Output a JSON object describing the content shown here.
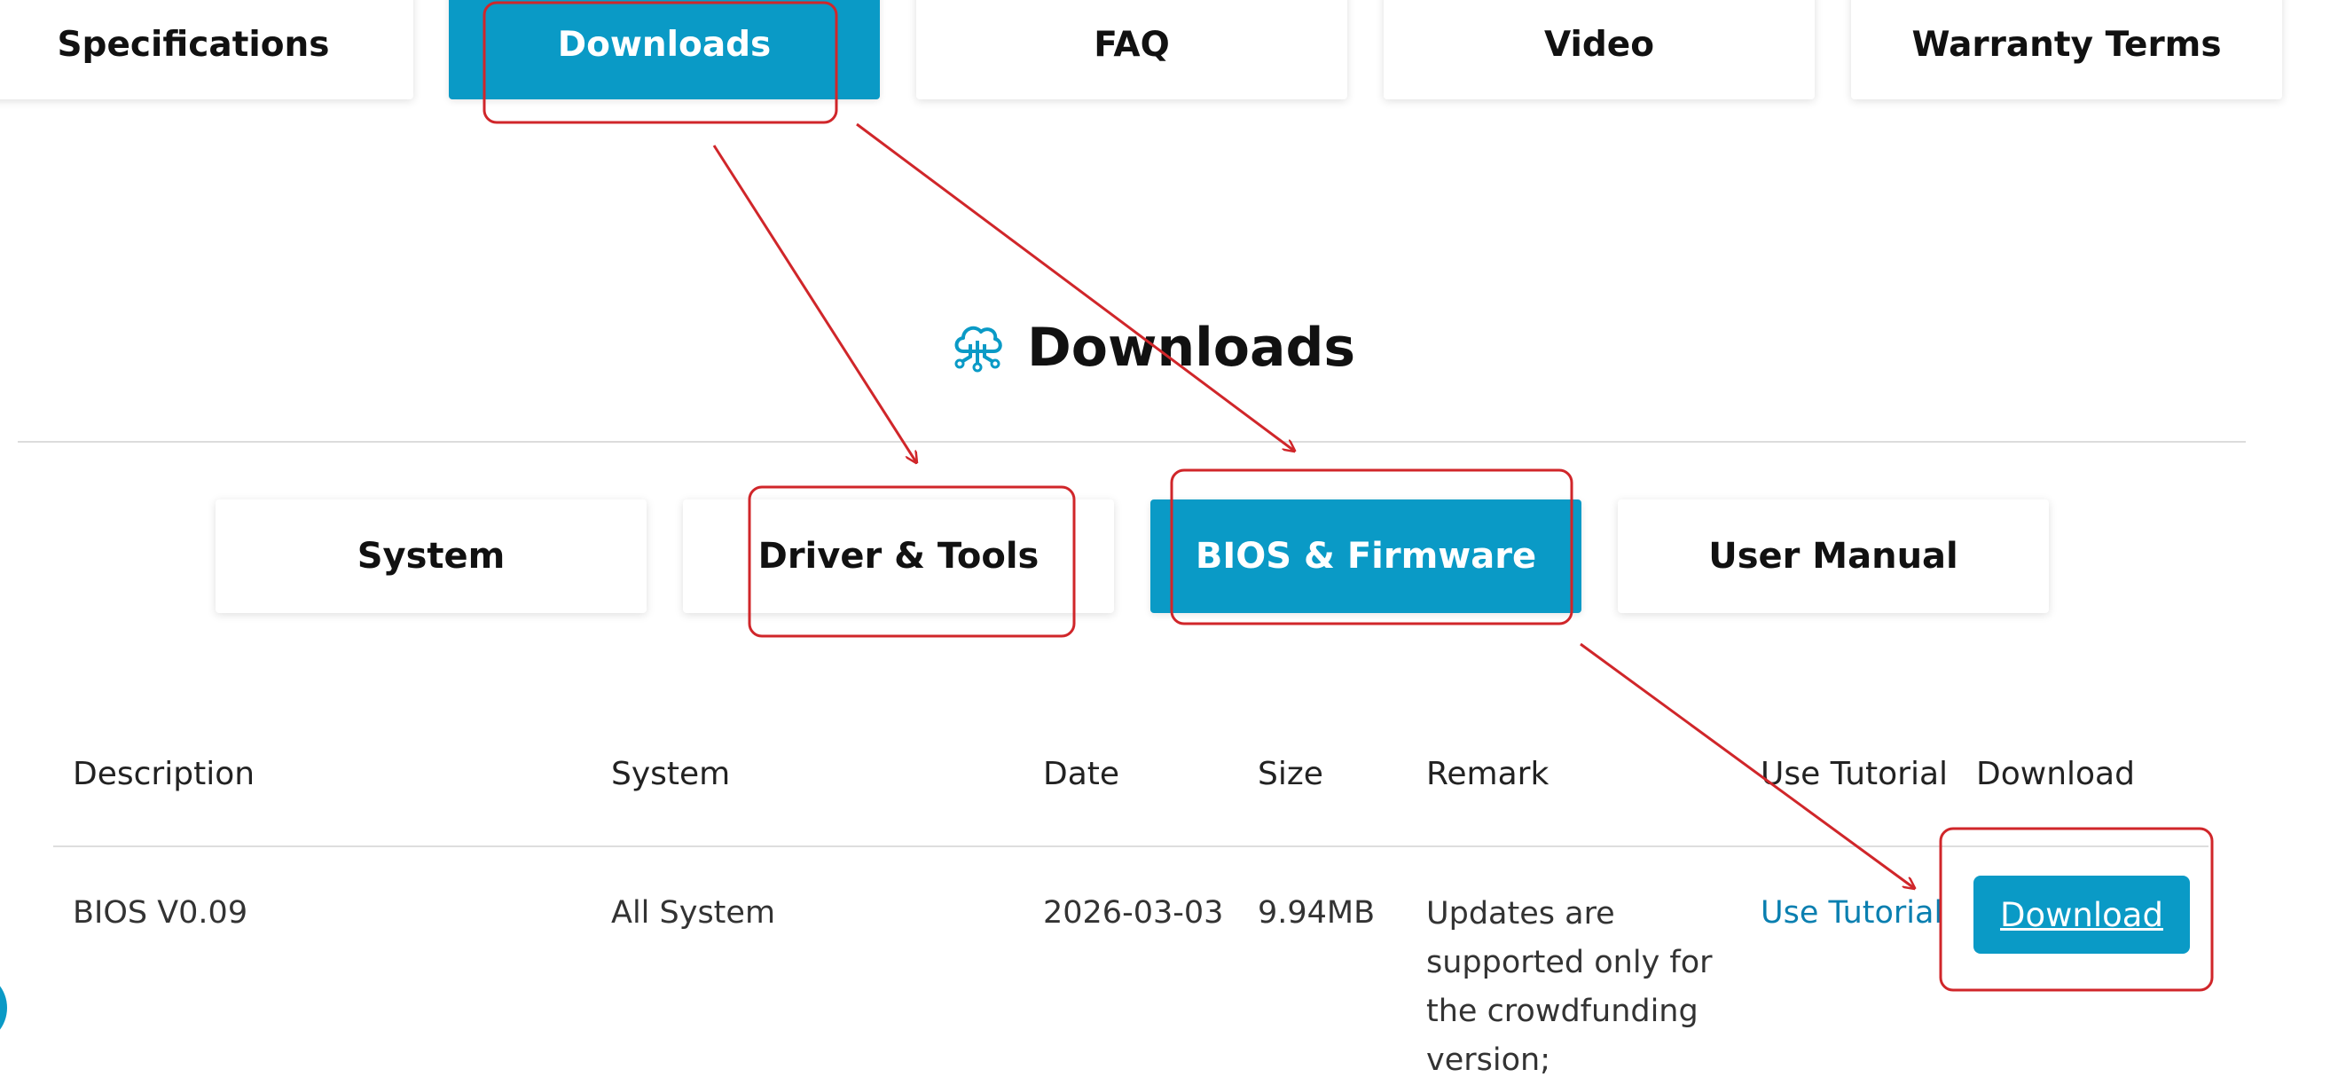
{
  "top_tabs": [
    {
      "label": "Specifications",
      "active": false
    },
    {
      "label": "Downloads",
      "active": true
    },
    {
      "label": "FAQ",
      "active": false
    },
    {
      "label": "Video",
      "active": false
    },
    {
      "label": "Warranty Terms",
      "active": false
    }
  ],
  "section": {
    "title": "Downloads",
    "icon": "cloud-network-icon"
  },
  "sub_tabs": [
    {
      "label": "System",
      "active": false
    },
    {
      "label": "Driver & Tools",
      "active": false
    },
    {
      "label": "BIOS & Firmware",
      "active": true
    },
    {
      "label": "User Manual",
      "active": false
    }
  ],
  "table": {
    "headers": [
      "Description",
      "System",
      "Date",
      "Size",
      "Remark",
      "Use Tutorial",
      "Download"
    ],
    "rows": [
      {
        "description": "BIOS V0.09",
        "system": "All System",
        "date": "2026-03-03",
        "size": "9.94MB",
        "remark": "Updates are supported only for the crowdfunding version;",
        "tutorial_link": "Use Tutorial",
        "download_label": "Download"
      }
    ]
  },
  "colors": {
    "accent": "#0a9ac6",
    "annotation": "#d0262a"
  }
}
